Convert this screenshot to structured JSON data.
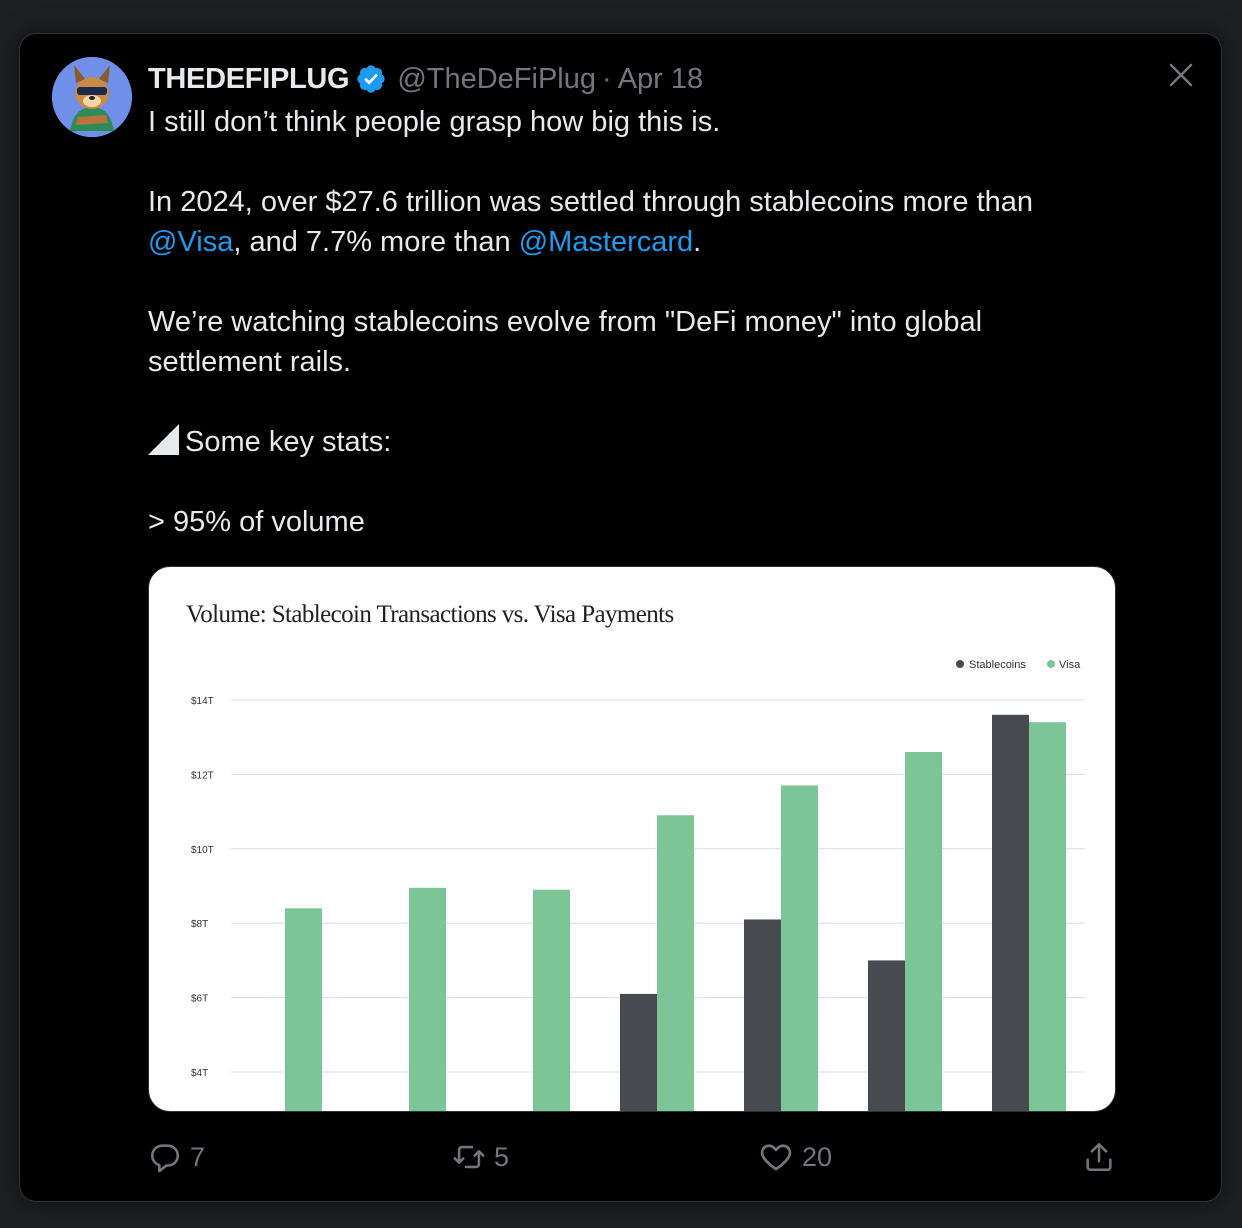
{
  "author": {
    "display_name": "THEDEFIPLUG",
    "handle": "@TheDeFiPlug",
    "separator": "·",
    "date": "Apr 18",
    "avatar_icon": "cartoon-dog-avatar"
  },
  "tweet": {
    "line1": "I still don’t think people grasp how big this is.",
    "line2a": "In 2024, over $27.6 trillion was settled through stablecoins more than",
    "mention_visa": "@Visa",
    "line2b": ", and 7.7% more than ",
    "mention_mastercard": "@Mastercard",
    "line2c": ".",
    "line3": "We’re watching stablecoins evolve from \"DeFi money\" into global settlement rails.",
    "line4": "Some key stats:",
    "line5": "> 95% of volume"
  },
  "actions": {
    "replies": "7",
    "retweets": "5",
    "likes": "20"
  },
  "colors": {
    "mention": "#1d9bf0",
    "stablecoins": "#474a4e",
    "visa": "#7cc597"
  },
  "chart_data": {
    "type": "bar",
    "title": "Volume: Stablecoin Transactions vs. Visa Payments",
    "legend_position": "top-right",
    "grid": true,
    "ylim": [
      2.9,
      14.4
    ],
    "yticks": [
      4,
      6,
      8,
      10,
      12,
      14
    ],
    "ytick_labels": [
      "$4T",
      "$6T",
      "$8T",
      "$10T",
      "$12T",
      "$14T"
    ],
    "series": [
      {
        "name": "Stablecoins",
        "values": [
          null,
          null,
          null,
          6.1,
          8.1,
          7.0,
          13.6
        ]
      },
      {
        "name": "Visa",
        "values": [
          8.4,
          8.95,
          8.9,
          10.9,
          11.7,
          12.6,
          13.4
        ]
      }
    ]
  }
}
